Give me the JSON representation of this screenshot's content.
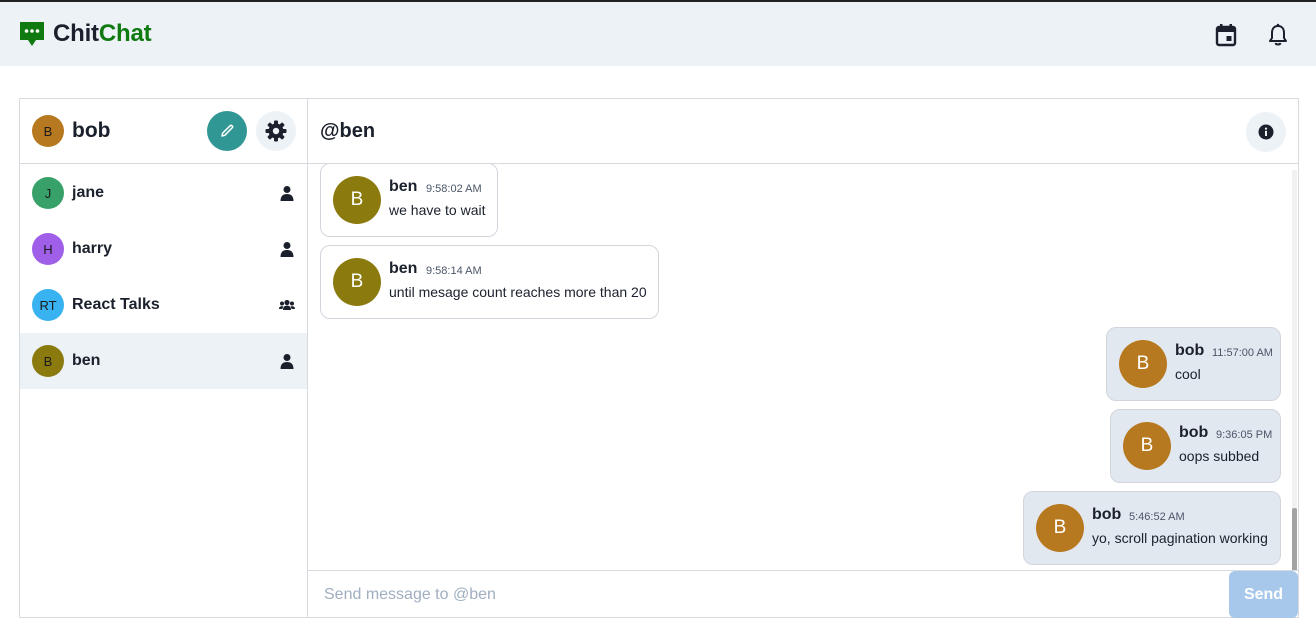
{
  "app": {
    "name_part1": "Chit",
    "name_part2": "Chat",
    "colors": {
      "brand_green": "#0f7a0f",
      "header_bg": "#edf2f7",
      "accent_teal": "#319795"
    }
  },
  "top_actions": [
    {
      "icon": "calendar-icon"
    },
    {
      "icon": "bell-icon"
    }
  ],
  "sidebar": {
    "current_user": {
      "initials": "B",
      "name": "bob",
      "avatar_color": "#b7791f"
    },
    "actions": [
      {
        "icon": "pencil-icon"
      },
      {
        "icon": "gear-icon"
      }
    ],
    "conversations": [
      {
        "initials": "J",
        "name": "jane",
        "avatar_color": "#38a169",
        "type_icon": "user-icon",
        "active": false
      },
      {
        "initials": "H",
        "name": "harry",
        "avatar_color": "#9f5fe8",
        "type_icon": "user-icon",
        "active": false
      },
      {
        "initials": "RT",
        "name": "React Talks",
        "avatar_color": "#38b2f0",
        "type_icon": "users-icon",
        "active": false
      },
      {
        "initials": "B",
        "name": "ben",
        "avatar_color": "#8b7a0e",
        "type_icon": "user-icon",
        "active": true
      }
    ]
  },
  "chat": {
    "title": "@ben",
    "info_icon": "info-icon",
    "messages": [
      {
        "from": "ben",
        "initials": "B",
        "time": "9:58:02 AM",
        "text": "we have to wait",
        "mine": false
      },
      {
        "from": "ben",
        "initials": "B",
        "time": "9:58:14 AM",
        "text": "until mesage count reaches more than 20",
        "mine": false
      },
      {
        "from": "bob",
        "initials": "B",
        "time": "11:57:00 AM",
        "text": "cool",
        "mine": true
      },
      {
        "from": "bob",
        "initials": "B",
        "time": "9:36:05 PM",
        "text": "oops subbed",
        "mine": true
      },
      {
        "from": "bob",
        "initials": "B",
        "time": "5:46:52 AM",
        "text": "yo, scroll pagination working",
        "mine": true
      }
    ],
    "composer": {
      "value": "",
      "placeholder": "Send message to @ben",
      "send_label": "Send"
    }
  }
}
